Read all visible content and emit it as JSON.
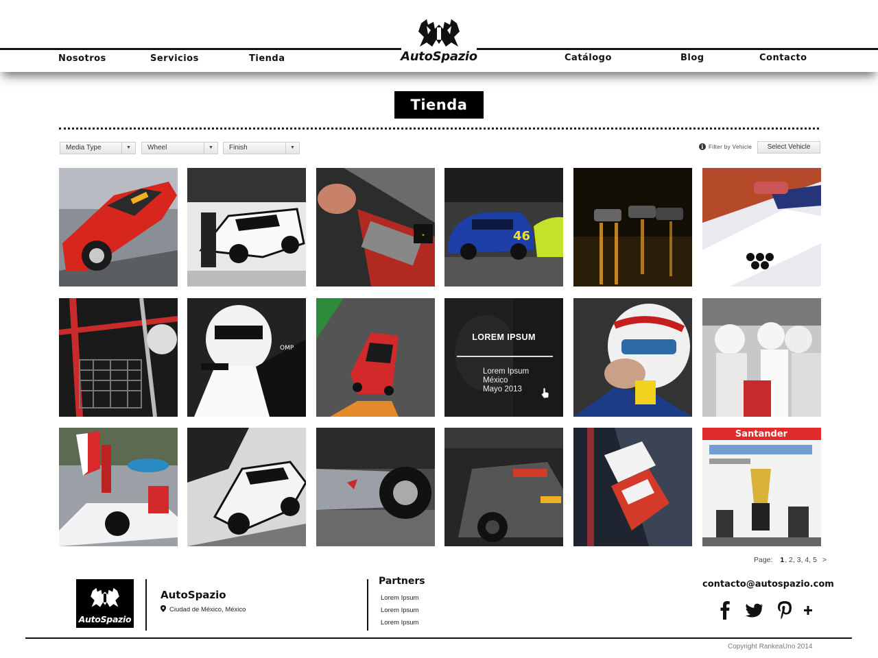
{
  "header": {
    "logo_text": "AutoSpazio",
    "nav_left": [
      "Nosotros",
      "Servicios",
      "Tienda"
    ],
    "nav_right": [
      "Catálogo",
      "Blog",
      "Contacto"
    ]
  },
  "page": {
    "title": "Tienda"
  },
  "filters": {
    "media_type": "Media Type",
    "wheel": "Wheel",
    "finish": "Finish",
    "filter_label": "Filter by Vehicle",
    "vehicle_button": "Select Vehicle"
  },
  "gallery": {
    "tiles": [
      "red-classic-car-photo",
      "black-white-race-car-photo",
      "mechanic-engine-photo",
      "blue-rally-cars-photo",
      "night-race-lights-photo",
      "white-formula-car-photo",
      "roll-cage-cockpit-photo",
      "driver-helmet-bw-photo",
      "red-touring-car-photo",
      "driver-portrait-hover-photo",
      "driver-helmet-photo",
      "pit-crew-photo",
      "grid-girl-formula-photo",
      "aston-martin-bw-photo",
      "vintage-racer-photo",
      "black-gt-car-photo",
      "touring-cars-track-photo",
      "podium-trophy-photo"
    ],
    "overlay": {
      "title": "LOREM IPSUM",
      "line1": "Lorem Ipsum",
      "line2": "México",
      "line3": "Mayo 2013"
    }
  },
  "pagination": {
    "label": "Page:",
    "current": "1",
    "others": ", 2, 3, 4, 5",
    "next": ">"
  },
  "footer": {
    "logo_text": "AutoSpazio",
    "company": "AutoSpazio",
    "location": "Ciudad de México, México",
    "partners_title": "Partners",
    "partners": [
      "Lorem Ipsum",
      "Lorem Ipsum",
      "Lorem Ipsum"
    ],
    "email": "contacto@autospazio.com",
    "social": [
      "facebook-icon",
      "twitter-icon",
      "pinterest-icon",
      "plus-icon"
    ],
    "copyright": "Copyright RankeaUno 2014"
  }
}
